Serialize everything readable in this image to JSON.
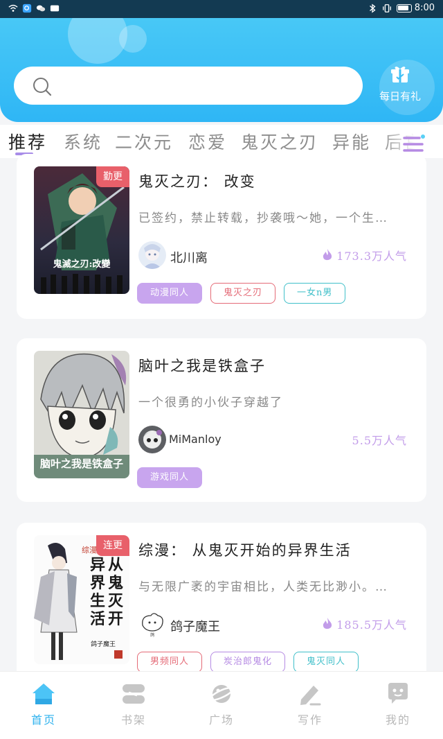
{
  "status_bar": {
    "time": "8:00"
  },
  "header": {
    "daily_gift_label": "每日有礼"
  },
  "tabs": [
    "推荐",
    "系统",
    "二次元",
    "恋爱",
    "鬼灭之刃",
    "异能",
    "后宫"
  ],
  "books": [
    {
      "badge": "勤更",
      "cover_text": "鬼滅之刃:改變",
      "title": "鬼灭之刃： 改变",
      "desc": "已签约，禁止转载，抄袭哦～她，一个生…",
      "author": "北川离",
      "popularity": "173.3万人气",
      "tags": [
        "动漫同人",
        "鬼灭之刃",
        "一女n男"
      ]
    },
    {
      "badge": "",
      "cover_text": "脑叶之我是铁盒子",
      "title": "脑叶之我是铁盒子",
      "desc": "一个很勇的小伙子穿越了",
      "author": "MiManloy",
      "popularity": "5.5万人气",
      "tags": [
        "游戏同人"
      ]
    },
    {
      "badge": "连更",
      "cover_text": "从鬼灭开始异界生活",
      "cover_author": "鸽子魔王",
      "title": "综漫： 从鬼灭开始的异界生活",
      "desc": "与无限广袤的宇宙相比，人类无比渺小。…",
      "author": "鸽子魔王",
      "popularity": "185.5万人气",
      "tags": [
        "男频同人",
        "炭治郎鬼化",
        "鬼灭同人"
      ]
    }
  ],
  "bottom_nav": [
    "首页",
    "书架",
    "广场",
    "写作",
    "我的"
  ],
  "colors": {
    "accent": "#2fb2ee",
    "header": "#3dbff5",
    "popularity": "#c29ce9",
    "badge": "#e8606a"
  }
}
